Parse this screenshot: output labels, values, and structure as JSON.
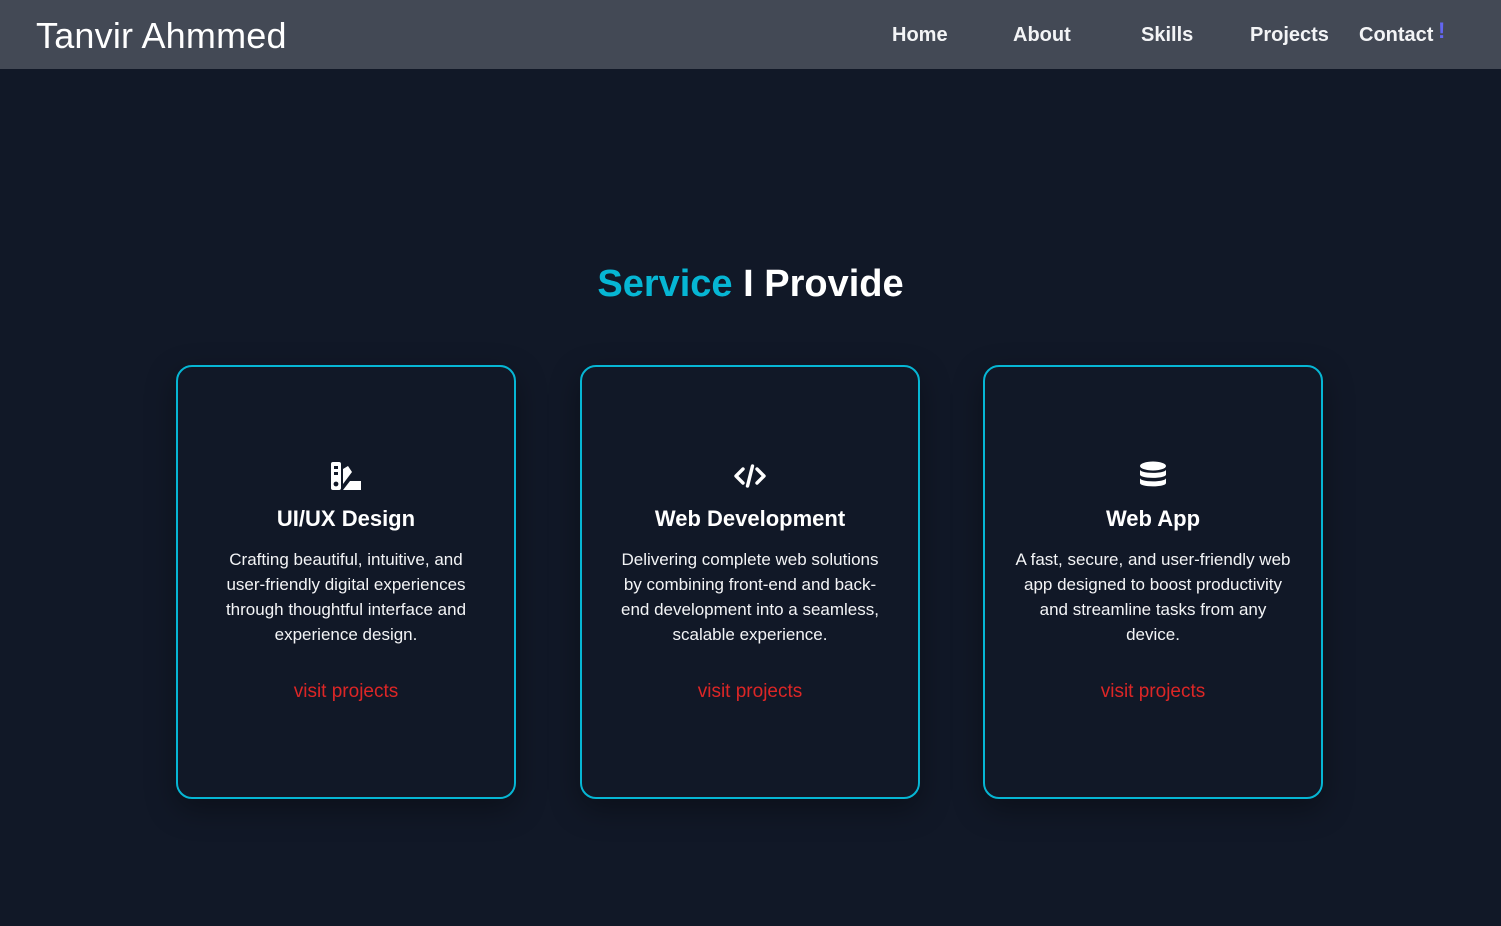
{
  "header": {
    "brand": "Tanvir Ahmmed",
    "nav": {
      "home": "Home",
      "about": "About",
      "skills": "Skills",
      "projects": "Projects",
      "contact": "Contact"
    },
    "alert_mark": "!"
  },
  "services": {
    "title_accent": "Service",
    "title_rest": " I Provide",
    "cards": [
      {
        "icon": "design-swatch-icon",
        "title": "UI/UX Design",
        "description": "Crafting beautiful, intuitive, and user-friendly digital experiences through thoughtful interface and experience design.",
        "link": "visit projects"
      },
      {
        "icon": "code-icon",
        "title": "Web Development",
        "description": "Delivering complete web solutions by combining front-end and back-end development into a seamless, scalable experience.",
        "link": "visit projects"
      },
      {
        "icon": "database-icon",
        "title": "Web App",
        "description": "A fast, secure, and user-friendly web app designed to boost productivity and streamline tasks from any device.",
        "link": "visit projects"
      }
    ]
  },
  "colors": {
    "background": "#111827",
    "navbar": "#434955",
    "accent": "#06b6d4",
    "link": "#dc2626",
    "alert": "#6366f1"
  }
}
